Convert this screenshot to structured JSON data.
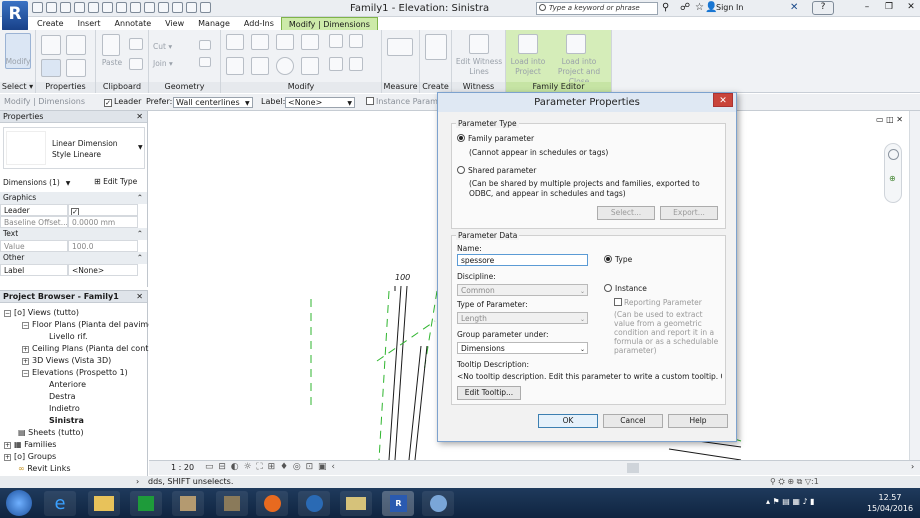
{
  "window": {
    "title": "Family1 - Elevation: Sinistra",
    "logo": "R",
    "search_placeholder": "Type a keyword or phrase",
    "sign_in": "Sign In"
  },
  "tabs": [
    {
      "label": "Create"
    },
    {
      "label": "Insert"
    },
    {
      "label": "Annotate"
    },
    {
      "label": "View"
    },
    {
      "label": "Manage"
    },
    {
      "label": "Add-Ins"
    },
    {
      "label": "Modify | Dimensions"
    }
  ],
  "ribbon": {
    "panels": [
      {
        "label": "Select ▾"
      },
      {
        "label": "Properties"
      },
      {
        "label": "Clipboard"
      },
      {
        "label": "Geometry"
      },
      {
        "label": "Modify"
      },
      {
        "label": "Measure"
      },
      {
        "label": "Create"
      },
      {
        "label": "Witness Lines"
      },
      {
        "label": "Family Editor"
      }
    ],
    "modify": "Modify",
    "paste": "Paste",
    "cut": "Cut ▾",
    "join": "Join ▾",
    "edit_witness": "Edit Witness Lines",
    "load_project": "Load into Project",
    "load_close": "Load into Project and Close"
  },
  "options_bar": {
    "context": "Modify | Dimensions",
    "leader": "Leader",
    "prefer_label": "Prefer:",
    "prefer_value": "Wall centerlines",
    "label_label": "Label:",
    "label_value": "<None>",
    "instance_param": "Instance Paramet"
  },
  "properties": {
    "title": "Properties",
    "type_name": "Linear Dimension Style Lineare",
    "selector": "Dimensions (1)",
    "edit_type": "Edit Type",
    "groups": [
      {
        "name": "Graphics",
        "rows": [
          {
            "label": "Leader",
            "value": "✓"
          },
          {
            "label": "Baseline Offset...",
            "value": "0.0000 mm"
          }
        ]
      },
      {
        "name": "Text",
        "rows": [
          {
            "label": "Value",
            "value": "100.0"
          }
        ]
      },
      {
        "name": "Other",
        "rows": [
          {
            "label": "Label",
            "value": "<None>"
          }
        ]
      }
    ]
  },
  "browser": {
    "title": "Project Browser - Family1",
    "items": [
      {
        "label": "Views (tutto)"
      },
      {
        "label": "Floor Plans (Pianta del pavime"
      },
      {
        "label": "Livello rif."
      },
      {
        "label": "Ceiling Plans (Pianta del contr"
      },
      {
        "label": "3D Views (Vista 3D)"
      },
      {
        "label": "Elevations (Prospetto 1)"
      },
      {
        "label": "Anteriore"
      },
      {
        "label": "Destra"
      },
      {
        "label": "Indietro"
      },
      {
        "label": "Sinistra"
      },
      {
        "label": "Sheets (tutto)"
      },
      {
        "label": "Families"
      },
      {
        "label": "Groups"
      },
      {
        "label": "Revit Links"
      }
    ]
  },
  "canvas": {
    "dimension_text": "100",
    "scale": "1 : 20"
  },
  "status": {
    "text": "dds, SHIFT unselects."
  },
  "taskbar": {
    "time": "12.57",
    "date": "15/04/2016"
  },
  "dialog": {
    "title": "Parameter Properties",
    "param_type_title": "Parameter Type",
    "family_param": "Family parameter",
    "family_note": "(Cannot appear in schedules or tags)",
    "shared_param": "Shared parameter",
    "shared_note": "(Can be shared by multiple projects and families, exported to ODBC, and appear in schedules and tags)",
    "select_btn": "Select...",
    "export_btn": "Export...",
    "data_title": "Parameter Data",
    "name_label": "Name:",
    "name_value": "spessore",
    "discipline_label": "Discipline:",
    "discipline_value": "Common",
    "type_of_param_label": "Type of Parameter:",
    "type_of_param_value": "Length",
    "group_label": "Group parameter under:",
    "group_value": "Dimensions",
    "type_radio": "Type",
    "instance_radio": "Instance",
    "reporting": "Reporting Parameter",
    "reporting_note": "(Can be used to extract value from a geometric condition and report it in a formula or as a schedulable parameter)",
    "tooltip_label": "Tooltip Description:",
    "tooltip_value": "<No tooltip description. Edit this parameter to write a custom tooltip. Custom t...",
    "edit_tooltip": "Edit Tooltip...",
    "ok": "OK",
    "cancel": "Cancel",
    "help": "Help"
  },
  "colors": {
    "accent_tab": "#cdeaa9",
    "ribbon_bg": "#f0f2f5",
    "dialog_close": "#c9443a",
    "dashed_green": "#2fb52f"
  }
}
